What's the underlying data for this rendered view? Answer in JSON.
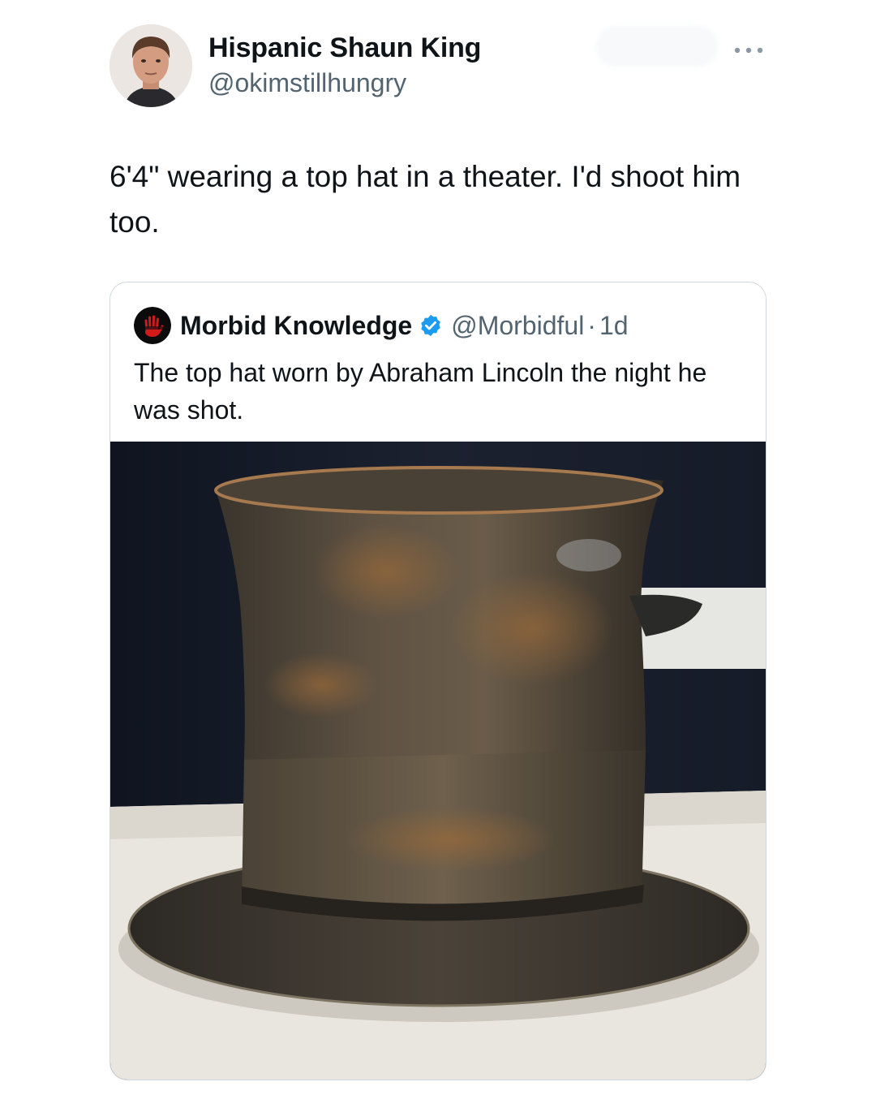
{
  "author": {
    "display_name": "Hispanic Shaun King",
    "handle": "@okimstillhungry",
    "avatar_icon": "profile-photo"
  },
  "tweet": {
    "text": "6'4\" wearing a top hat in a theater. I'd shoot him too."
  },
  "more_icon": "more-horizontal-icon",
  "quoted": {
    "display_name": "Morbid Knowledge",
    "verified": true,
    "verified_color": "#1d9bf0",
    "handle": "@Morbidful",
    "separator": "·",
    "time": "1d",
    "text": "The top hat worn by Abraham Lincoln the night he was shot.",
    "media_icon": "photo-top-hat"
  },
  "colors": {
    "text_primary": "#0f1419",
    "text_secondary": "#536471",
    "border": "#cfd9de",
    "accent": "#1d9bf0"
  }
}
